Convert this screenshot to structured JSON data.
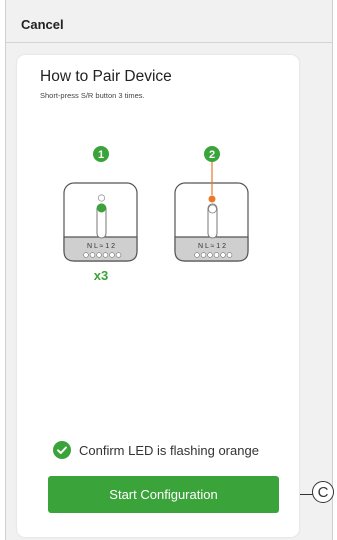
{
  "header": {
    "cancel_label": "Cancel"
  },
  "card": {
    "title": "How to Pair Device",
    "subtitle": "Short-press S/R button 3 times."
  },
  "illustration": {
    "step1_number": "1",
    "step2_number": "2",
    "terminal_labels": "N L ≈ 1 2",
    "press_count": "x3",
    "led_color_step1": "#3aa33a",
    "led_color_step2": "#e8782a"
  },
  "confirm": {
    "text": "Confirm LED is flashing orange"
  },
  "actions": {
    "start_label": "Start Configuration"
  },
  "callout": {
    "label": "C"
  },
  "colors": {
    "accent": "#3aa33a",
    "orange": "#e8782a"
  }
}
